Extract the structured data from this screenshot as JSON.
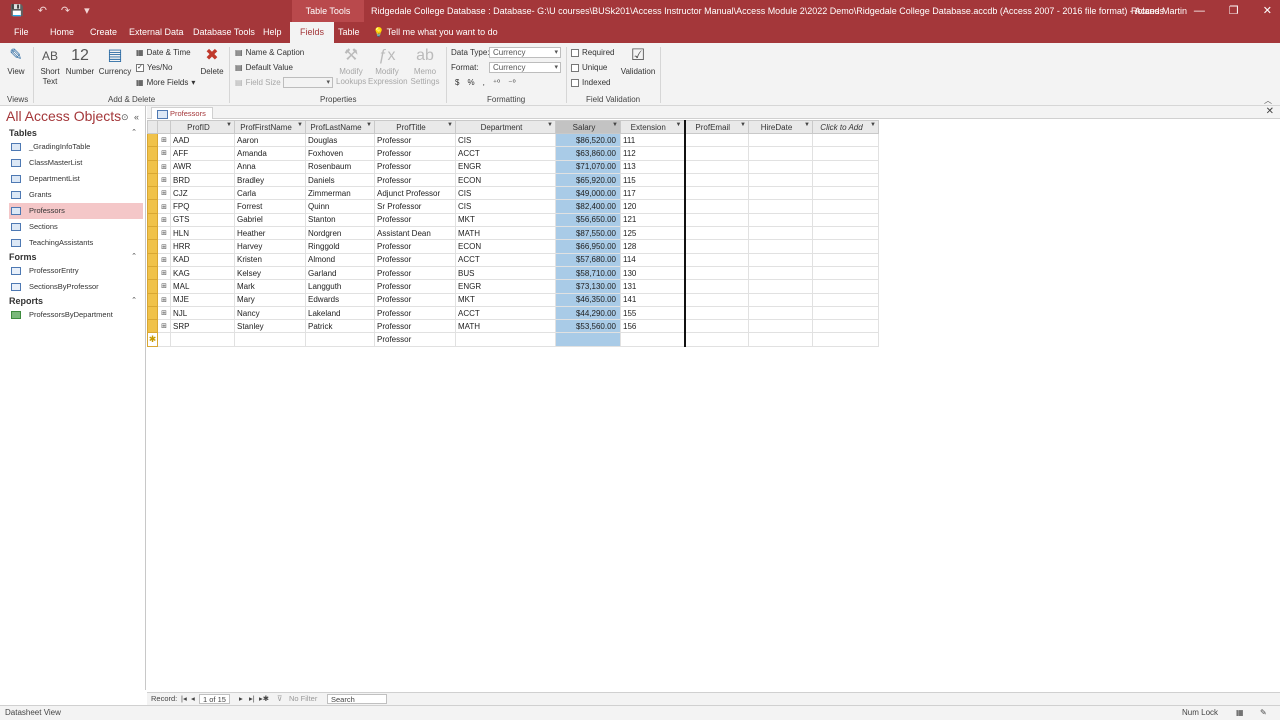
{
  "title_bar": {
    "context_group": "Table Tools",
    "window_title": "Ridgedale College Database : Database- G:\\U courses\\BUSk201\\Access Instructor Manual\\Access Module 2\\2022 Demo\\Ridgedale College Database.accdb (Access 2007 - 2016 file format) - Access",
    "user": "Roland Martin"
  },
  "ribbon_tabs": [
    "File",
    "Home",
    "Create",
    "External Data",
    "Database Tools",
    "Help",
    "Fields",
    "Table"
  ],
  "tell_me": "Tell me what you want to do",
  "ribbon": {
    "views": {
      "view_label": "View",
      "group": "Views"
    },
    "add_delete": {
      "short_text": "Short Text",
      "short_text_icon": "AB",
      "number": "Number",
      "number_icon": "12",
      "currency": "Currency",
      "date_time": "Date & Time",
      "yes_no": "Yes/No",
      "more_fields": "More Fields",
      "delete": "Delete",
      "group": "Add & Delete"
    },
    "properties": {
      "name_caption": "Name & Caption",
      "default_value": "Default Value",
      "field_size": "Field Size",
      "modify_lookups": "Modify Lookups",
      "modify_expression": "Modify Expression",
      "memo_settings": "Memo Settings",
      "group": "Properties"
    },
    "formatting": {
      "data_type_label": "Data Type:",
      "data_type_value": "Currency",
      "format_label": "Format:",
      "format_value": "Currency",
      "group": "Formatting"
    },
    "field_validation": {
      "required": "Required",
      "unique": "Unique",
      "indexed": "Indexed",
      "validation": "Validation",
      "group": "Field Validation"
    }
  },
  "nav_pane": {
    "title": "All Access Objects",
    "sections": [
      {
        "name": "Tables",
        "items": [
          "_GradingInfoTable",
          "ClassMasterList",
          "DepartmentList",
          "Grants",
          "Professors",
          "Sections",
          "TeachingAssistants"
        ]
      },
      {
        "name": "Forms",
        "items": [
          "ProfessorEntry",
          "SectionsByProfessor"
        ]
      },
      {
        "name": "Reports",
        "items": [
          "ProfessorsByDepartment"
        ]
      }
    ],
    "selected_item": "Professors"
  },
  "document_tab": "Professors",
  "datasheet": {
    "columns": [
      "ProfID",
      "ProfFirstName",
      "ProfLastName",
      "ProfTitle",
      "Department",
      "Salary",
      "Extension",
      "ProfEmail",
      "HireDate",
      "Click to Add"
    ],
    "rows": [
      [
        "AAD",
        "Aaron",
        "Douglas",
        "Professor",
        "CIS",
        "$86,520.00",
        "111",
        "",
        ""
      ],
      [
        "AFF",
        "Amanda",
        "Foxhoven",
        "Professor",
        "ACCT",
        "$63,860.00",
        "112",
        "",
        ""
      ],
      [
        "AWR",
        "Anna",
        "Rosenbaum",
        "Professor",
        "ENGR",
        "$71,070.00",
        "113",
        "",
        ""
      ],
      [
        "BRD",
        "Bradley",
        "Daniels",
        "Professor",
        "ECON",
        "$65,920.00",
        "115",
        "",
        ""
      ],
      [
        "CJZ",
        "Carla",
        "Zimmerman",
        "Adjunct Professor",
        "CIS",
        "$49,000.00",
        "117",
        "",
        ""
      ],
      [
        "FPQ",
        "Forrest",
        "Quinn",
        "Sr Professor",
        "CIS",
        "$82,400.00",
        "120",
        "",
        ""
      ],
      [
        "GTS",
        "Gabriel",
        "Stanton",
        "Professor",
        "MKT",
        "$56,650.00",
        "121",
        "",
        ""
      ],
      [
        "HLN",
        "Heather",
        "Nordgren",
        "Assistant Dean",
        "MATH",
        "$87,550.00",
        "125",
        "",
        ""
      ],
      [
        "HRR",
        "Harvey",
        "Ringgold",
        "Professor",
        "ECON",
        "$66,950.00",
        "128",
        "",
        ""
      ],
      [
        "KAD",
        "Kristen",
        "Almond",
        "Professor",
        "ACCT",
        "$57,680.00",
        "114",
        "",
        ""
      ],
      [
        "KAG",
        "Kelsey",
        "Garland",
        "Professor",
        "BUS",
        "$58,710.00",
        "130",
        "",
        ""
      ],
      [
        "MAL",
        "Mark",
        "Langguth",
        "Professor",
        "ENGR",
        "$73,130.00",
        "131",
        "",
        ""
      ],
      [
        "MJE",
        "Mary",
        "Edwards",
        "Professor",
        "MKT",
        "$46,350.00",
        "141",
        "",
        ""
      ],
      [
        "NJL",
        "Nancy",
        "Lakeland",
        "Professor",
        "ACCT",
        "$44,290.00",
        "155",
        "",
        ""
      ],
      [
        "SRP",
        "Stanley",
        "Patrick",
        "Professor",
        "MATH",
        "$53,560.00",
        "156",
        "",
        ""
      ]
    ],
    "new_row_default_title": "Professor",
    "selected_column": "Salary"
  },
  "record_nav": {
    "label": "Record:",
    "position": "1 of 15",
    "filter": "No Filter",
    "search": "Search"
  },
  "status_bar": {
    "view": "Datasheet View",
    "num_lock": "Num Lock"
  },
  "colors": {
    "accent": "#a4373a",
    "selection": "#a9cbe7",
    "row_selector": "#f0c24a"
  }
}
